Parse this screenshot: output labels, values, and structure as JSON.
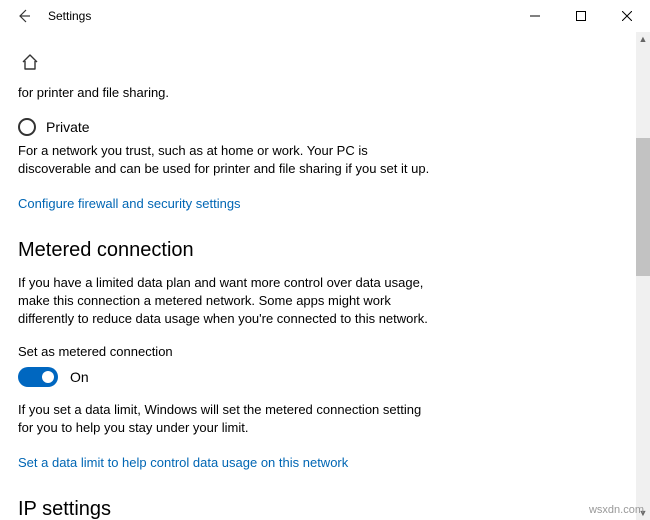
{
  "titlebar": {
    "title": "Settings"
  },
  "network": {
    "partial_desc": "for printer and file sharing.",
    "private_label": "Private",
    "private_desc": "For a network you trust, such as at home or work. Your PC is discoverable and can be used for printer and file sharing if you set it up.",
    "firewall_link": "Configure firewall and security settings"
  },
  "metered": {
    "title": "Metered connection",
    "desc": "If you have a limited data plan and want more control over data usage, make this connection a metered network. Some apps might work differently to reduce data usage when you're connected to this network.",
    "toggle_label": "Set as metered connection",
    "toggle_state": "On",
    "limit_desc": "If you set a data limit, Windows will set the metered connection setting for you to help you stay under your limit.",
    "limit_link": "Set a data limit to help control data usage on this network"
  },
  "ip": {
    "title": "IP settings"
  },
  "watermark": "wsxdn.com"
}
